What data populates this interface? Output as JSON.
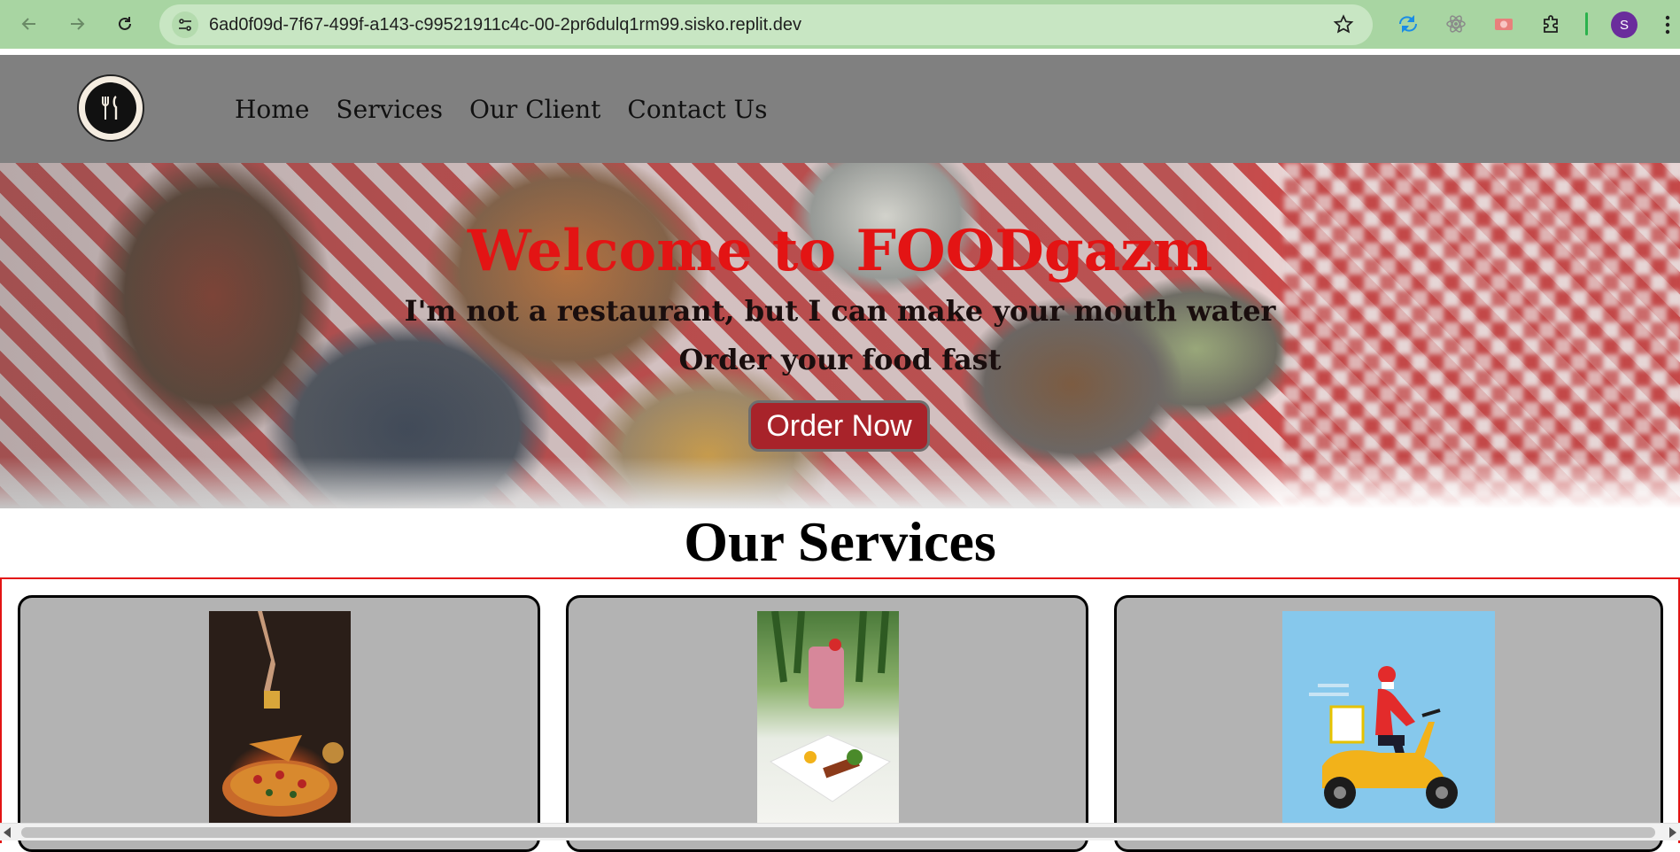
{
  "browser": {
    "url": "6ad0f09d-7f67-499f-a143-c99521911c4c-00-2pr6dulq1rm99.sisko.replit.dev",
    "profile_initial": "S",
    "toolbar_color": "#a8d5a2",
    "icons": [
      "back-icon",
      "forward-icon",
      "reload-icon",
      "site-info-icon",
      "bookmark-star-icon",
      "extension-sync-icon",
      "extension-react-icon",
      "extension-camera-icon",
      "extensions-puzzle-icon",
      "menu-dots-icon"
    ]
  },
  "site": {
    "nav": {
      "home": "Home",
      "services": "Services",
      "client": "Our Client",
      "contact": "Contact Us"
    },
    "hero": {
      "title": "Welcome to FOODgazm",
      "subtitle": "I'm not a restaurant, but I can make your mouth water",
      "tagline": "Order your food fast",
      "cta": "Order Now"
    },
    "services": {
      "heading": "Our Services",
      "cards": [
        {
          "image": "pizza-photo"
        },
        {
          "image": "breakfast-smoothie-photo"
        },
        {
          "image": "scooter-delivery-illustration"
        }
      ]
    },
    "colors": {
      "header_bg": "#808080",
      "title_red": "#e31414",
      "button_bg": "#a8232a",
      "card_bg": "#b3b3b3"
    }
  }
}
